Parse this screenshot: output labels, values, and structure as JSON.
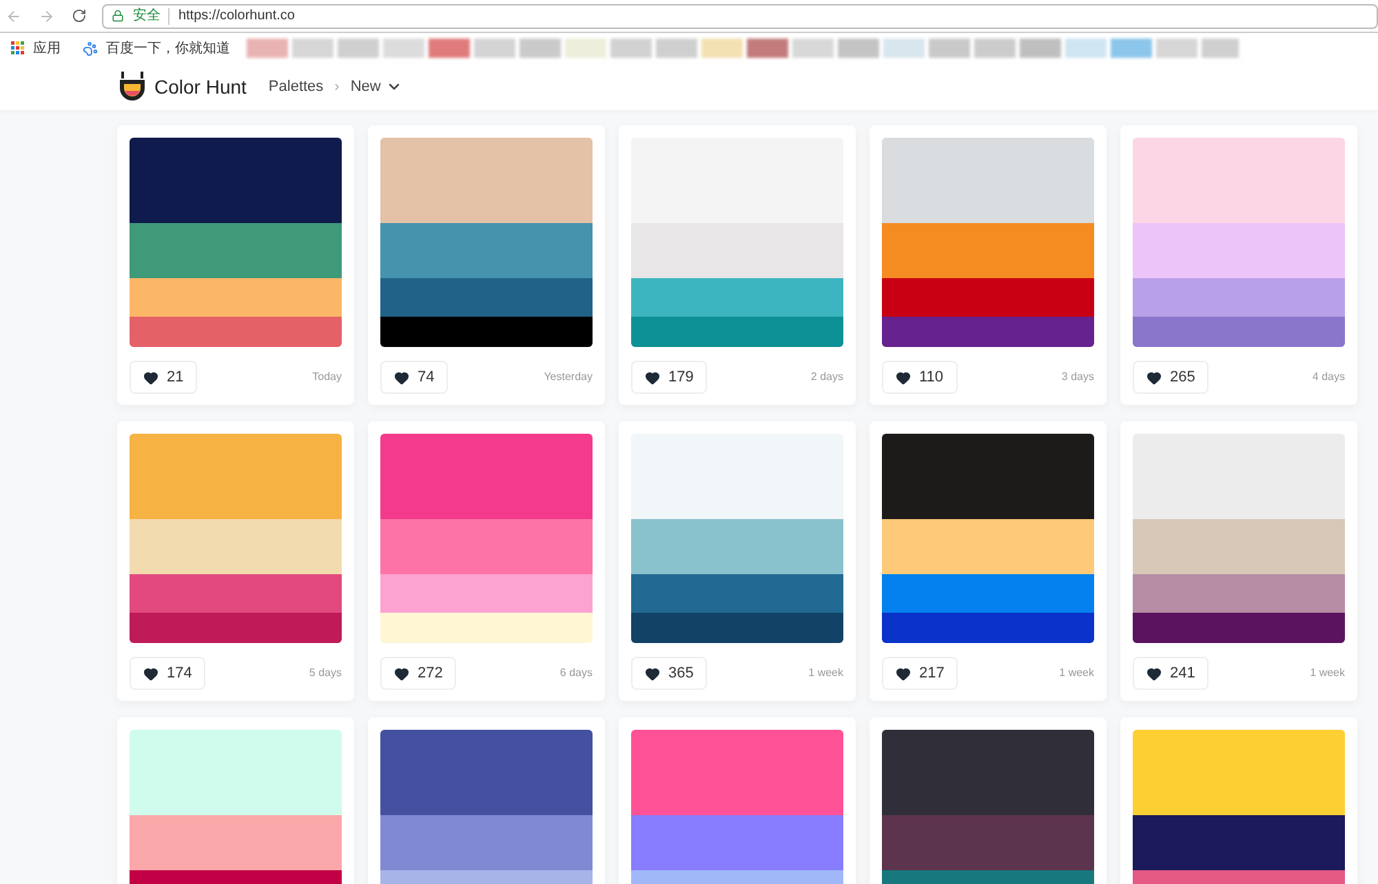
{
  "browser": {
    "security_label": "安全",
    "url": "https://colorhunt.co"
  },
  "bookmarks": [
    {
      "label": "应用",
      "kind": "apps"
    },
    {
      "label": "百度一下，你就知道",
      "kind": "paw"
    }
  ],
  "site": {
    "brand": "Color Hunt",
    "nav": [
      {
        "label": "Palettes",
        "kind": "link"
      },
      {
        "label": "›",
        "kind": "separator"
      },
      {
        "label": "New",
        "kind": "dropdown"
      }
    ]
  },
  "palettes": [
    {
      "colors": [
        {
          "color": "#0f1b4c"
        },
        {
          "color": "#3f9a7a"
        },
        {
          "color": "#fbb767"
        },
        {
          "color": "#e46167"
        }
      ],
      "likes": "21",
      "age": "Today"
    },
    {
      "colors": [
        {
          "color": "#e3c2a8"
        },
        {
          "color": "#4593ac"
        },
        {
          "color": "#216288"
        },
        {
          "color": "#000000"
        }
      ],
      "likes": "74",
      "age": "Yesterday"
    },
    {
      "colors": [
        {
          "color": "#f4f4f4"
        },
        {
          "color": "#e8e6e6"
        },
        {
          "color": "#3db5c0"
        },
        {
          "color": "#0e9196"
        }
      ],
      "likes": "179",
      "age": "2 days"
    },
    {
      "colors": [
        {
          "color": "#d9dde0"
        },
        {
          "color": "#f58c22"
        },
        {
          "color": "#c90014"
        },
        {
          "color": "#66228e"
        }
      ],
      "likes": "110",
      "age": "3 days"
    },
    {
      "colors": [
        {
          "color": "#fdd6e6"
        },
        {
          "color": "#ecc4f9"
        },
        {
          "color": "#b8a1e8"
        },
        {
          "color": "#8a76cb"
        }
      ],
      "likes": "265",
      "age": "4 days"
    },
    {
      "colors": [
        {
          "color": "#f6b243"
        },
        {
          "color": "#f3dbb0"
        },
        {
          "color": "#e24a7f"
        },
        {
          "color": "#be1b58"
        }
      ],
      "likes": "174",
      "age": "5 days"
    },
    {
      "colors": [
        {
          "color": "#f43a8d"
        },
        {
          "color": "#fd73a7"
        },
        {
          "color": "#fca3d1"
        },
        {
          "color": "#fff6d3"
        }
      ],
      "likes": "272",
      "age": "6 days"
    },
    {
      "colors": [
        {
          "color": "#f1f6f8"
        },
        {
          "color": "#89c2cd"
        },
        {
          "color": "#226a93"
        },
        {
          "color": "#124266"
        }
      ],
      "likes": "365",
      "age": "1 week"
    },
    {
      "colors": [
        {
          "color": "#1d1a1a"
        },
        {
          "color": "#fec978"
        },
        {
          "color": "#0481ee"
        },
        {
          "color": "#0a33c9"
        }
      ],
      "likes": "217",
      "age": "1 week"
    },
    {
      "colors": [
        {
          "color": "#ececec"
        },
        {
          "color": "#d7c8b8"
        },
        {
          "color": "#b68da5"
        },
        {
          "color": "#5b1360"
        }
      ],
      "likes": "241",
      "age": "1 week"
    },
    {
      "colors": [
        {
          "color": "#cffcec"
        },
        {
          "color": "#fba8aa"
        },
        {
          "color": "#c20045"
        }
      ]
    },
    {
      "colors": [
        {
          "color": "#4450a0"
        },
        {
          "color": "#808ad4"
        },
        {
          "color": "#a7b4e8"
        }
      ]
    },
    {
      "colors": [
        {
          "color": "#fe5196"
        },
        {
          "color": "#887dfc"
        },
        {
          "color": "#a0b8f8"
        }
      ]
    },
    {
      "colors": [
        {
          "color": "#302e38"
        },
        {
          "color": "#5d344d"
        },
        {
          "color": "#17797d"
        }
      ]
    },
    {
      "colors": [
        {
          "color": "#fecf32"
        },
        {
          "color": "#1c1a5a"
        },
        {
          "color": "#e45a84"
        }
      ]
    }
  ]
}
